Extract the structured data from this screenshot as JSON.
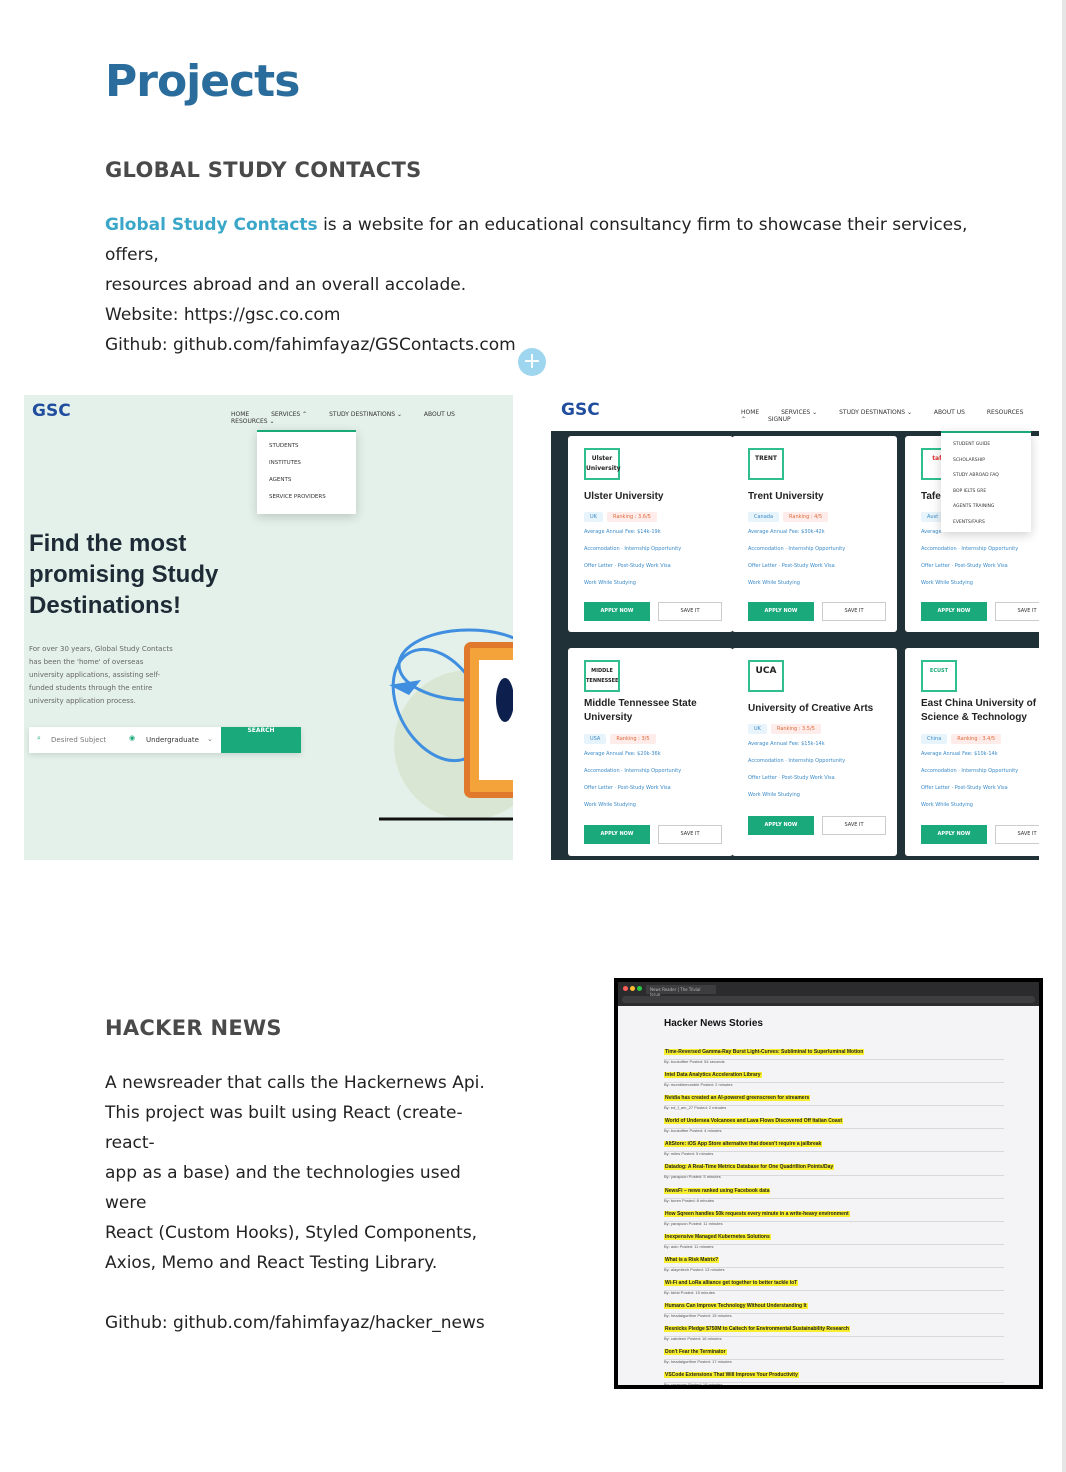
{
  "page": {
    "title": "Projects"
  },
  "gsc": {
    "heading": "GLOBAL STUDY CONTACTS",
    "link_text": "Global Study Contacts",
    "desc_1": " is a website for an educational consultancy firm to showcase their services, offers,",
    "desc_2": "resources abroad and an overall accolade.",
    "website": "Website: https://gsc.co.com",
    "github": "Github: github.com/fahimfayaz/GSContacts.com",
    "plus_glyph": "+",
    "shot1": {
      "logo": "GSC",
      "nav": [
        "HOME",
        "SERVICES ⌃",
        "STUDY DESTINATIONS ⌄",
        "ABOUT US",
        "RESOURCES ⌄"
      ],
      "services_menu": [
        "STUDENTS",
        "INSTITUTES",
        "AGENTS",
        "SERVICE PROVIDERS"
      ],
      "hero_title": "Find the most promising Study Destinations!",
      "hero_text": "For over 30 years, Global Study Contacts has been the 'home' of overseas university applications, assisting self-funded students through the entire university application process.",
      "search_placeholder": "Desired Subject",
      "level": "Undergraduate",
      "search_button": "SEARCH"
    },
    "shot2": {
      "logo": "GSC",
      "nav": [
        "HOME",
        "SERVICES ⌄",
        "STUDY DESTINATIONS ⌄",
        "ABOUT US",
        "RESOURCES ⌃",
        "SIGNUP"
      ],
      "resources_menu": [
        "STUDENT GUIDE",
        "SCHOLARSHIP",
        "STUDY ABROAD FAQ",
        "BOP IELTS GRE",
        "AGENTS TRAINING",
        "EVENTS/FAIRS"
      ],
      "cards": [
        {
          "logo": "Ulster University",
          "name": "Ulster University",
          "country": "UK",
          "ranking": "Ranking : 3.6/5",
          "fee": "Average Annual Fee: $14k-19k"
        },
        {
          "logo": "TRENT",
          "name": "Trent University",
          "country": "Canada",
          "ranking": "Ranking : 4/5",
          "fee": "Average Annual Fee: $30k-42k"
        },
        {
          "logo": "tafe",
          "name": "Tafe Q",
          "country": "Aust",
          "ranking": "",
          "fee": "Average"
        },
        {
          "logo": "MIDDLE TENNESSEE",
          "name": "Middle Tennessee State University",
          "country": "USA",
          "ranking": "Ranking : 3/5",
          "fee": "Average Annual Fee: $20k-36k"
        },
        {
          "logo": "UCA",
          "name": "University of Creative Arts",
          "country": "UK",
          "ranking": "Ranking : 3.5/5",
          "fee": "Average Annual Fee: $15k-14k"
        },
        {
          "logo": "ECUST",
          "name": "East China University of Science & Technology",
          "country": "China",
          "ranking": "Ranking : 3.4/5",
          "fee": "Average Annual Fee: $10k-14k"
        }
      ],
      "features": [
        "Accomodation",
        "Internship Opportunity",
        "Offer Letter",
        "Post-Study Work Visa",
        "Work While Studying"
      ],
      "apply": "APPLY NOW",
      "save": "SAVE IT"
    }
  },
  "hn": {
    "heading": "HACKER NEWS",
    "p1": "A newsreader that calls the Hackernews Api.",
    "p2": "This project was built using React (create-react-",
    "p3": "app as a base) and the technologies used were",
    "p4": "React (Custom Hooks), Styled Components,",
    "p5": "Axios, Memo and React Testing Library.",
    "github": "Github: github.com/fahimfayaz/hacker_news",
    "shot": {
      "tab": "News Reader | The Trivial Issue",
      "page_title": "Hacker News Stories",
      "stories": [
        {
          "t": "Time-Reversed Gamma-Ray Burst Light-Curves: Subliminal to Superluminal Motion",
          "b": "By: bookoffee  Posted: 54 seconds"
        },
        {
          "t": "Intel Data Analytics Acceleration Library",
          "b": "By: mumblemumble  Posted: 2 minutes"
        },
        {
          "t": "Nvidia has created an AI-powered greenscreen for streamers",
          "b": "By: ed_f_am_27  Posted: 2 minutes"
        },
        {
          "t": "World of Undersea Volcanoes and Lava Flows Discovered Off Italian Coast",
          "b": "By: bookoffee  Posted: 4 minutes"
        },
        {
          "t": "AltStore: iOS App Store alternative that doesn't require a jailbreak",
          "b": "By: miles  Posted: 5 minutes"
        },
        {
          "t": "Datadog: A Real-Time Metrics Database for One Quadrillion Points/Day",
          "b": "By: yarapoon  Posted: 5 minutes"
        },
        {
          "t": "NewsFi – news ranked using Facebook data",
          "b": "By: tumm  Posted: 8 minutes"
        },
        {
          "t": "How Sqreen handles 50k requests every minute in a write-heavy environment",
          "b": "By: yarapoon  Posted: 11 minutes"
        },
        {
          "t": "Inexpensive Managed Kubernetes Solutions",
          "b": "By: aoin  Posted: 11 minutes"
        },
        {
          "t": "What is a Risk Matrix?",
          "b": "By: alaymtech  Posted: 13 minutes"
        },
        {
          "t": "Wi-Fi and LoRa alliance get together to better tackle IoT",
          "b": "By: tdrist  Posted: 15 minutes"
        },
        {
          "t": "Humans Can Improve Technology Without Understanding It",
          "b": "By: headalgorithm  Posted: 15 minutes"
        },
        {
          "t": "Resnicks Pledge $750M to Caltech for Environmental Sustainability Research",
          "b": "By: cabdeen  Posted: 16 minutes"
        },
        {
          "t": "Don't Fear the Terminator",
          "b": "By: headalgorithm  Posted: 17 minutes"
        },
        {
          "t": "VSCode Extensions That Will Improve Your Productivity",
          "b": "By: coracoac  Posted: 19 minutes"
        }
      ]
    }
  }
}
